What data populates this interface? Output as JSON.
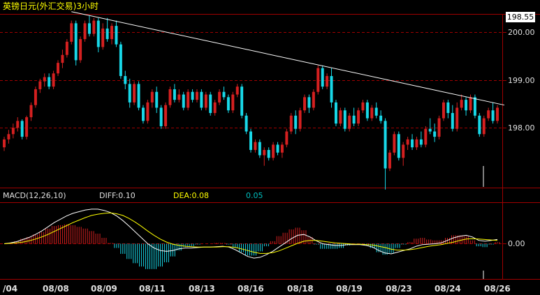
{
  "title": "英镑日元(外汇交易)3小时",
  "colors": {
    "background": "#000000",
    "up": "#d42020",
    "down": "#18d8e8",
    "grid": "#a00000",
    "axis_text": "#e0e0e0",
    "trendline": "#ffffff",
    "diff": "#ffffff",
    "dea": "#ffff00",
    "title": "#ffff00",
    "label_value": "#00c0c0"
  },
  "price_panel": {
    "current_price_badge": "198.55",
    "y_ticks": [
      "200.00",
      "199.00",
      "198.00"
    ]
  },
  "macd_panel": {
    "label": "MACD(12,26,10)",
    "diff_label": "DIFF:0.10",
    "dea_label": "DEA:0.08",
    "macd_value": "0.05",
    "zero_tick": "0.00"
  },
  "x_axis": {
    "labels": [
      "/04",
      "08/08",
      "08/09",
      "08/11",
      "08/13",
      "08/16",
      "08/18",
      "08/19",
      "08/23",
      "08/24",
      "08/26"
    ]
  },
  "chart_data": [
    {
      "type": "candlestick",
      "title": "英镑日元(外汇交易)3小时",
      "x_labels": [
        "/04",
        "08/08",
        "08/09",
        "08/11",
        "08/13",
        "08/16",
        "08/18",
        "08/19",
        "08/23",
        "08/24",
        "08/26"
      ],
      "ylim": [
        197.1,
        200.35
      ],
      "y_ticks": [
        198.0,
        199.0,
        200.0
      ],
      "grid": true,
      "last_price": 198.55,
      "trendline": {
        "from": 200.42,
        "to": 198.65
      },
      "ohlc": [
        [
          197.85,
          198.05,
          197.78,
          198.0
        ],
        [
          198.0,
          198.18,
          197.92,
          198.1
        ],
        [
          198.1,
          198.3,
          198.02,
          198.22
        ],
        [
          198.22,
          198.42,
          198.15,
          198.35
        ],
        [
          198.35,
          198.38,
          198.0,
          198.05
        ],
        [
          198.05,
          198.45,
          198.0,
          198.42
        ],
        [
          198.42,
          198.7,
          198.35,
          198.65
        ],
        [
          198.65,
          199.0,
          198.6,
          198.95
        ],
        [
          198.95,
          199.15,
          198.88,
          199.1
        ],
        [
          199.1,
          199.25,
          199.0,
          199.18
        ],
        [
          199.18,
          199.25,
          198.95,
          199.0
        ],
        [
          199.0,
          199.3,
          198.95,
          199.25
        ],
        [
          199.25,
          199.5,
          199.2,
          199.45
        ],
        [
          199.45,
          199.7,
          199.35,
          199.6
        ],
        [
          199.6,
          199.9,
          199.55,
          199.85
        ],
        [
          199.85,
          200.25,
          199.8,
          200.2
        ],
        [
          200.2,
          200.25,
          199.4,
          199.5
        ],
        [
          199.5,
          199.95,
          199.45,
          199.9
        ],
        [
          199.9,
          200.25,
          199.85,
          200.2
        ],
        [
          200.2,
          200.35,
          199.95,
          200.0
        ],
        [
          200.0,
          200.3,
          199.95,
          200.25
        ],
        [
          200.25,
          200.3,
          199.65,
          199.75
        ],
        [
          199.75,
          200.2,
          199.7,
          200.1
        ],
        [
          200.1,
          200.3,
          199.85,
          199.9
        ],
        [
          199.9,
          200.2,
          199.8,
          200.15
        ],
        [
          200.15,
          200.25,
          199.75,
          199.8
        ],
        [
          199.8,
          199.85,
          199.15,
          199.2
        ],
        [
          199.2,
          199.3,
          198.95,
          199.05
        ],
        [
          199.05,
          199.15,
          198.6,
          198.7
        ],
        [
          198.7,
          199.1,
          198.65,
          199.05
        ],
        [
          199.05,
          199.1,
          198.55,
          198.6
        ],
        [
          198.6,
          198.65,
          198.3,
          198.35
        ],
        [
          198.35,
          198.75,
          198.3,
          198.7
        ],
        [
          198.7,
          198.95,
          198.6,
          198.9
        ],
        [
          198.9,
          199.0,
          198.5,
          198.6
        ],
        [
          198.6,
          198.65,
          198.2,
          198.25
        ],
        [
          198.25,
          198.7,
          198.2,
          198.65
        ],
        [
          198.65,
          199.0,
          198.6,
          198.95
        ],
        [
          198.95,
          199.05,
          198.7,
          198.75
        ],
        [
          198.75,
          198.95,
          198.7,
          198.85
        ],
        [
          198.85,
          198.9,
          198.55,
          198.6
        ],
        [
          198.6,
          198.95,
          198.55,
          198.9
        ],
        [
          198.9,
          198.95,
          198.7,
          198.75
        ],
        [
          198.75,
          198.95,
          198.7,
          198.9
        ],
        [
          198.9,
          198.95,
          198.55,
          198.6
        ],
        [
          198.6,
          198.9,
          198.55,
          198.85
        ],
        [
          198.85,
          198.9,
          198.45,
          198.5
        ],
        [
          198.5,
          198.75,
          198.45,
          198.7
        ],
        [
          198.7,
          198.95,
          198.65,
          198.9
        ],
        [
          198.9,
          199.0,
          198.75,
          198.8
        ],
        [
          198.8,
          198.85,
          198.5,
          198.55
        ],
        [
          198.55,
          198.9,
          198.5,
          198.85
        ],
        [
          198.85,
          199.05,
          198.8,
          199.0
        ],
        [
          199.0,
          199.05,
          198.4,
          198.45
        ],
        [
          198.45,
          198.5,
          198.1,
          198.15
        ],
        [
          198.15,
          198.2,
          197.75,
          197.8
        ],
        [
          197.8,
          198.0,
          197.75,
          197.95
        ],
        [
          197.95,
          198.0,
          197.65,
          197.7
        ],
        [
          197.7,
          197.85,
          197.5,
          197.8
        ],
        [
          197.8,
          197.85,
          197.6,
          197.65
        ],
        [
          197.65,
          197.95,
          197.6,
          197.9
        ],
        [
          197.9,
          197.95,
          197.7,
          197.75
        ],
        [
          197.75,
          197.95,
          197.65,
          197.9
        ],
        [
          197.9,
          198.2,
          197.85,
          198.15
        ],
        [
          198.15,
          198.5,
          198.1,
          198.45
        ],
        [
          198.45,
          198.55,
          198.1,
          198.2
        ],
        [
          198.2,
          198.6,
          198.15,
          198.55
        ],
        [
          198.55,
          198.85,
          198.5,
          198.8
        ],
        [
          198.8,
          198.85,
          198.5,
          198.6
        ],
        [
          198.6,
          198.95,
          198.55,
          198.9
        ],
        [
          198.9,
          199.4,
          198.85,
          199.35
        ],
        [
          199.35,
          199.4,
          198.95,
          199.0
        ],
        [
          199.0,
          199.25,
          198.95,
          199.2
        ],
        [
          199.2,
          199.35,
          198.6,
          198.7
        ],
        [
          198.7,
          198.75,
          198.25,
          198.3
        ],
        [
          198.3,
          198.6,
          198.25,
          198.55
        ],
        [
          198.55,
          198.6,
          198.15,
          198.2
        ],
        [
          198.2,
          198.5,
          198.15,
          198.45
        ],
        [
          198.45,
          198.6,
          198.25,
          198.3
        ],
        [
          198.3,
          198.6,
          198.25,
          198.55
        ],
        [
          198.55,
          198.75,
          198.5,
          198.7
        ],
        [
          198.7,
          198.75,
          198.35,
          198.4
        ],
        [
          198.4,
          198.65,
          198.35,
          198.6
        ],
        [
          198.6,
          198.7,
          198.4,
          198.45
        ],
        [
          198.45,
          198.55,
          198.3,
          198.35
        ],
        [
          198.35,
          198.4,
          197.05,
          197.45
        ],
        [
          197.45,
          197.8,
          197.4,
          197.75
        ],
        [
          197.75,
          198.15,
          197.7,
          198.1
        ],
        [
          198.1,
          198.15,
          197.6,
          197.65
        ],
        [
          197.65,
          197.95,
          197.5,
          197.9
        ],
        [
          197.9,
          198.05,
          197.8,
          198.0
        ],
        [
          198.0,
          198.1,
          197.8,
          197.85
        ],
        [
          197.85,
          198.05,
          197.8,
          198.0
        ],
        [
          198.0,
          198.15,
          197.85,
          197.9
        ],
        [
          197.9,
          198.25,
          197.85,
          198.2
        ],
        [
          198.2,
          198.4,
          198.1,
          198.15
        ],
        [
          198.15,
          198.3,
          197.95,
          198.05
        ],
        [
          198.05,
          198.45,
          198.0,
          198.4
        ],
        [
          198.4,
          198.75,
          198.35,
          198.7
        ],
        [
          198.7,
          198.75,
          198.4,
          198.5
        ],
        [
          198.5,
          198.65,
          198.15,
          198.2
        ],
        [
          198.2,
          198.7,
          198.15,
          198.6
        ],
        [
          198.6,
          198.85,
          198.55,
          198.75
        ],
        [
          198.75,
          198.8,
          198.45,
          198.55
        ],
        [
          198.55,
          198.85,
          198.5,
          198.8
        ],
        [
          198.8,
          198.85,
          198.4,
          198.45
        ],
        [
          198.45,
          198.5,
          198.05,
          198.1
        ],
        [
          198.1,
          198.45,
          198.05,
          198.4
        ],
        [
          198.4,
          198.6,
          198.35,
          198.55
        ],
        [
          198.55,
          198.7,
          198.3,
          198.35
        ],
        [
          198.35,
          198.65,
          198.3,
          198.6
        ]
      ]
    },
    {
      "type": "macd",
      "params": [
        12,
        26,
        10
      ],
      "series": [
        {
          "name": "DIFF",
          "values": [
            0.0,
            0.02,
            0.05,
            0.1,
            0.15,
            0.22,
            0.3,
            0.4,
            0.5,
            0.58,
            0.66,
            0.72,
            0.76,
            0.8,
            0.82,
            0.82,
            0.79,
            0.74,
            0.66,
            0.55,
            0.42,
            0.28,
            0.14,
            0.0,
            -0.1,
            -0.16,
            -0.18,
            -0.16,
            -0.12,
            -0.1,
            -0.1,
            -0.09,
            -0.08,
            -0.08,
            -0.07,
            -0.06,
            -0.08,
            -0.14,
            -0.22,
            -0.3,
            -0.34,
            -0.32,
            -0.26,
            -0.18,
            -0.08,
            0.02,
            0.12,
            0.2,
            0.22,
            0.16,
            0.07,
            0.0,
            -0.02,
            -0.04,
            -0.04,
            -0.02,
            -0.02,
            -0.02,
            -0.04,
            -0.08,
            -0.16,
            -0.22,
            -0.24,
            -0.2,
            -0.16,
            -0.12,
            -0.06,
            -0.02,
            -0.01,
            0.0,
            0.02,
            0.08,
            0.14,
            0.18,
            0.2,
            0.16,
            0.08,
            0.06,
            0.08,
            0.1
          ]
        },
        {
          "name": "DEA",
          "values": [
            0.0,
            0.01,
            0.02,
            0.04,
            0.07,
            0.11,
            0.16,
            0.22,
            0.29,
            0.36,
            0.43,
            0.5,
            0.56,
            0.62,
            0.67,
            0.7,
            0.72,
            0.73,
            0.71,
            0.67,
            0.6,
            0.51,
            0.41,
            0.3,
            0.2,
            0.11,
            0.04,
            -0.01,
            -0.04,
            -0.06,
            -0.07,
            -0.08,
            -0.08,
            -0.08,
            -0.08,
            -0.07,
            -0.07,
            -0.09,
            -0.12,
            -0.16,
            -0.2,
            -0.23,
            -0.23,
            -0.21,
            -0.17,
            -0.11,
            -0.05,
            0.01,
            0.06,
            0.08,
            0.08,
            0.06,
            0.04,
            0.02,
            0.01,
            0.0,
            -0.01,
            -0.01,
            -0.02,
            -0.03,
            -0.06,
            -0.09,
            -0.13,
            -0.15,
            -0.15,
            -0.14,
            -0.12,
            -0.09,
            -0.06,
            -0.04,
            -0.02,
            0.01,
            0.04,
            0.08,
            0.11,
            0.12,
            0.11,
            0.1,
            0.09,
            0.08
          ]
        }
      ],
      "last": {
        "DIFF": 0.1,
        "DEA": 0.08,
        "MACD": 0.05
      },
      "zero_tick": 0.0
    }
  ]
}
